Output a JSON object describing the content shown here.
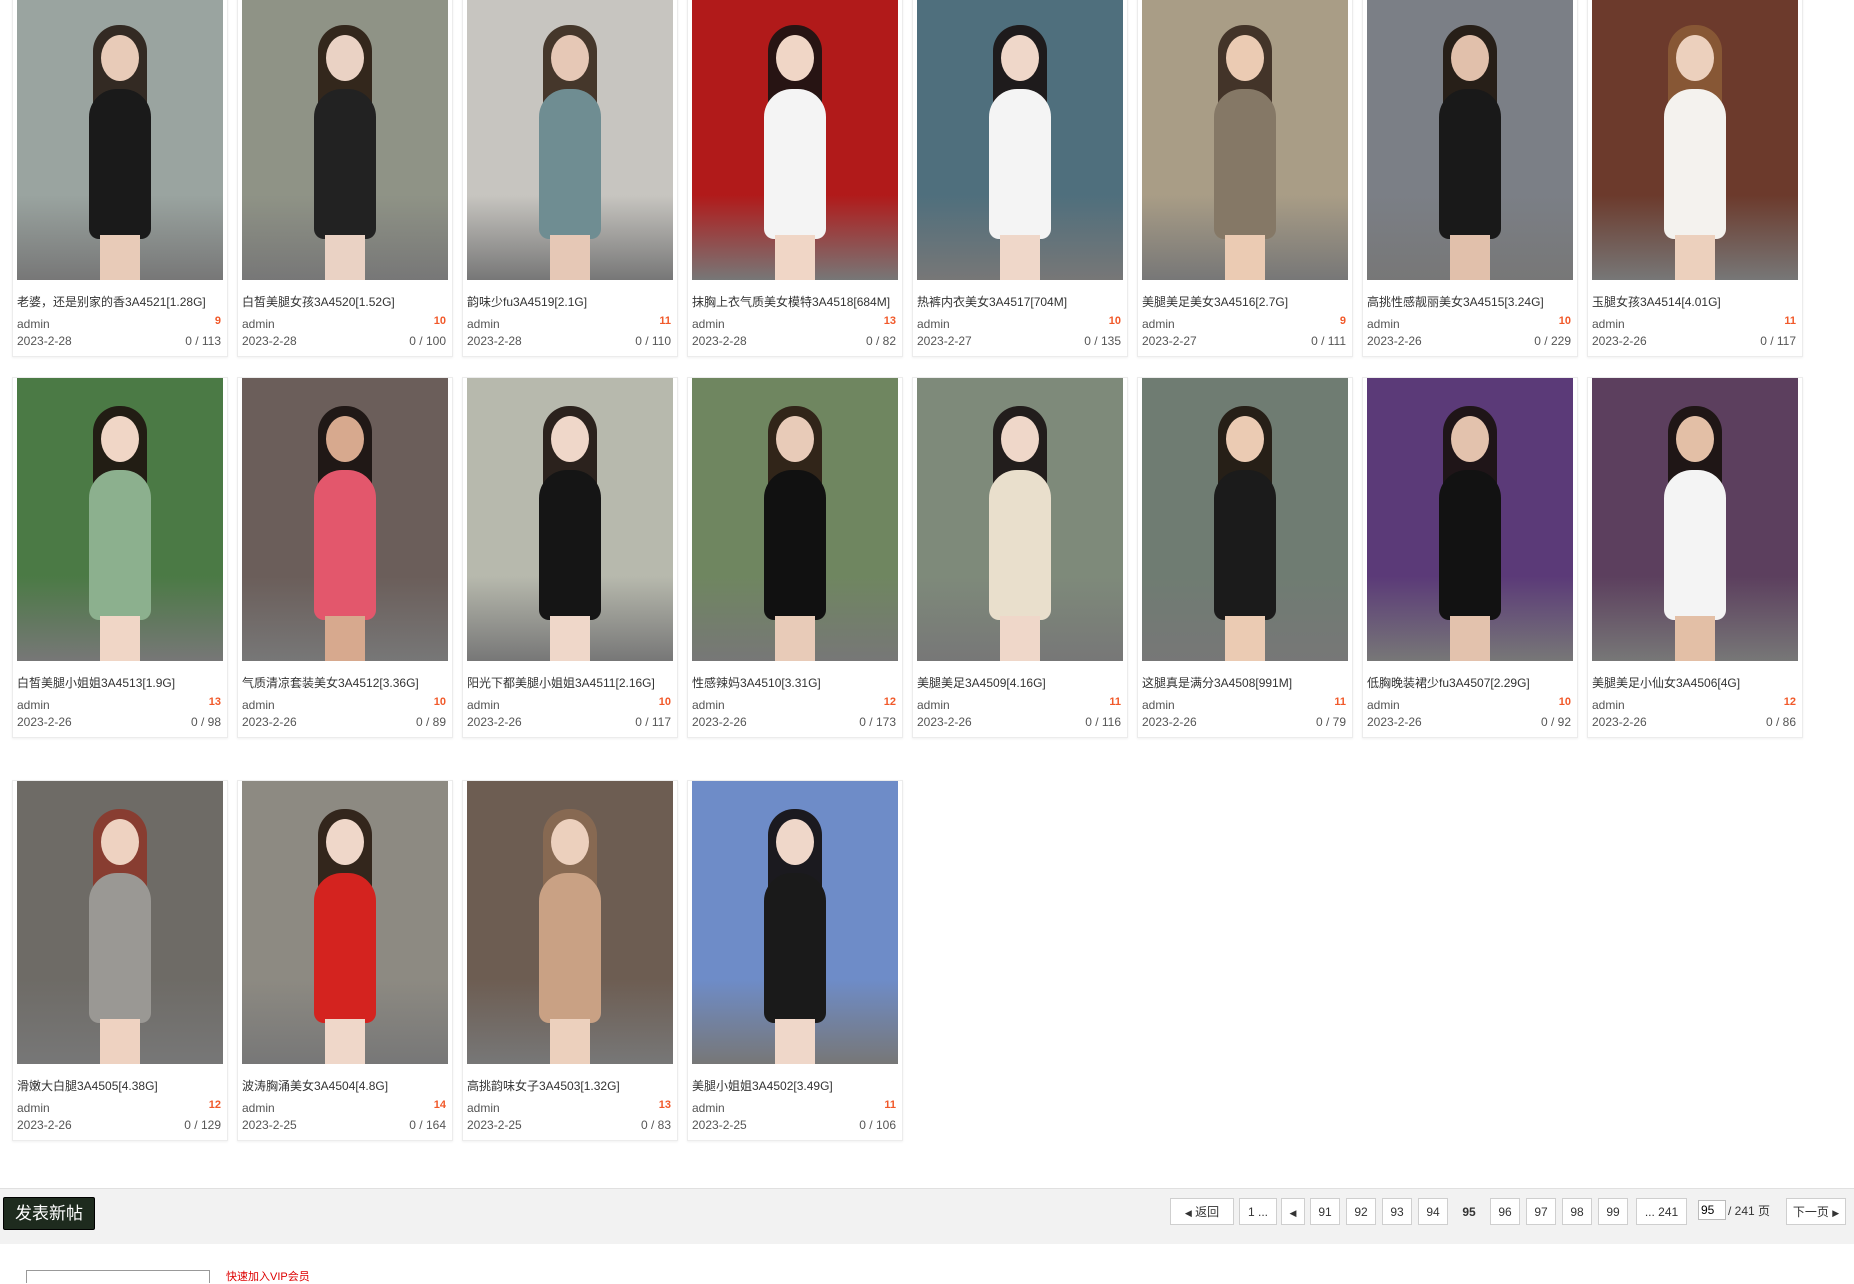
{
  "posts": [
    {
      "title": "老婆，还是别家的香3A4521[1.28G]",
      "author": "admin",
      "count": "9",
      "date": "2023-2-28",
      "views": "0 / 113",
      "palette": {
        "bg": "#9aa4a0",
        "body": "#1a1a1a",
        "hair": "#2a1f18",
        "skin": "#e8cbb8"
      }
    },
    {
      "title": "白皙美腿女孩3A4520[1.52G]",
      "author": "admin",
      "count": "10",
      "date": "2023-2-28",
      "views": "0 / 100",
      "palette": {
        "bg": "#8f9386",
        "body": "#222",
        "hair": "#2b1d14",
        "skin": "#ead2c4"
      }
    },
    {
      "title": "韵味少fu3A4519[2.1G]",
      "author": "admin",
      "count": "11",
      "date": "2023-2-28",
      "views": "0 / 110",
      "palette": {
        "bg": "#c7c5c0",
        "body": "#6f8d92",
        "hair": "#3a2a1e",
        "skin": "#e6c8b6"
      }
    },
    {
      "title": "抹胸上衣气质美女模特3A4518[684M]",
      "author": "admin",
      "count": "13",
      "date": "2023-2-28",
      "views": "0 / 82",
      "palette": {
        "bg": "#b11a1a",
        "body": "#f4f4f4",
        "hair": "#1b1412",
        "skin": "#f0d6c6"
      }
    },
    {
      "title": "热裤内衣美女3A4517[704M]",
      "author": "admin",
      "count": "10",
      "date": "2023-2-27",
      "views": "0 / 135",
      "palette": {
        "bg": "#4f6f7d",
        "body": "#f4f4f4",
        "hair": "#1a1414",
        "skin": "#efd7c9"
      }
    },
    {
      "title": "美腿美足美女3A4516[2.7G]",
      "author": "admin",
      "count": "9",
      "date": "2023-2-27",
      "views": "0 / 111",
      "palette": {
        "bg": "#a99d86",
        "body": "#857866",
        "hair": "#3b2b22",
        "skin": "#ebcbb3"
      }
    },
    {
      "title": "高挑性感靓丽美女3A4515[3.24G]",
      "author": "admin",
      "count": "10",
      "date": "2023-2-26",
      "views": "0 / 229",
      "palette": {
        "bg": "#7b7f86",
        "body": "#191919",
        "hair": "#20170f",
        "skin": "#e1c0ab"
      }
    },
    {
      "title": "玉腿女孩3A4514[4.01G]",
      "author": "admin",
      "count": "11",
      "date": "2023-2-26",
      "views": "0 / 117",
      "palette": {
        "bg": "#6c3a2c",
        "body": "#f4f2ee",
        "hair": "#8a5a36",
        "skin": "#ecd0bd"
      }
    },
    {
      "title": "白皙美腿小姐姐3A4513[1.9G]",
      "author": "admin",
      "count": "13",
      "date": "2023-2-26",
      "views": "0 / 98",
      "palette": {
        "bg": "#4b7a45",
        "body": "#8cb08e",
        "hair": "#1e1510",
        "skin": "#f0d6c6"
      }
    },
    {
      "title": "气质清凉套装美女3A4512[3.36G]",
      "author": "admin",
      "count": "10",
      "date": "2023-2-26",
      "views": "0 / 89",
      "palette": {
        "bg": "#6b5e5a",
        "body": "#e3576c",
        "hair": "#1a1210",
        "skin": "#d7a98e"
      }
    },
    {
      "title": "阳光下都美腿小姐姐3A4511[2.16G]",
      "author": "admin",
      "count": "10",
      "date": "2023-2-26",
      "views": "0 / 117",
      "palette": {
        "bg": "#b7b9ad",
        "body": "#151515",
        "hair": "#1e1510",
        "skin": "#efd7c9"
      }
    },
    {
      "title": "性感辣妈3A4510[3.31G]",
      "author": "admin",
      "count": "12",
      "date": "2023-2-26",
      "views": "0 / 173",
      "palette": {
        "bg": "#6f8660",
        "body": "#111",
        "hair": "#2b1d14",
        "skin": "#e8cbb8"
      }
    },
    {
      "title": "美腿美足3A4509[4.16G]",
      "author": "admin",
      "count": "11",
      "date": "2023-2-26",
      "views": "0 / 116",
      "palette": {
        "bg": "#7e8a7a",
        "body": "#e9dfcc",
        "hair": "#1a1414",
        "skin": "#efd7c9"
      }
    },
    {
      "title": "这腿真是满分3A4508[991M]",
      "author": "admin",
      "count": "11",
      "date": "2023-2-26",
      "views": "0 / 79",
      "palette": {
        "bg": "#6f7c72",
        "body": "#1b1b1b",
        "hair": "#20170f",
        "skin": "#ebcbb3"
      }
    },
    {
      "title": "低胸晚装裙少fu3A4507[2.29G]",
      "author": "admin",
      "count": "10",
      "date": "2023-2-26",
      "views": "0 / 92",
      "palette": {
        "bg": "#5b3a78",
        "body": "#121212",
        "hair": "#1a1210",
        "skin": "#e3c2ad"
      }
    },
    {
      "title": "美腿美足小仙女3A4506[4G]",
      "author": "admin",
      "count": "12",
      "date": "2023-2-26",
      "views": "0 / 86",
      "palette": {
        "bg": "#5c3f5e",
        "body": "#f4f4f4",
        "hair": "#1a1210",
        "skin": "#e3bfa6"
      }
    },
    {
      "title": "滑嫩大白腿3A4505[4.38G]",
      "author": "admin",
      "count": "12",
      "date": "2023-2-26",
      "views": "0 / 129",
      "palette": {
        "bg": "#6e6b66",
        "body": "#9a9894",
        "hair": "#8a3a2c",
        "skin": "#eed2c1"
      }
    },
    {
      "title": "波涛胸涌美女3A4504[4.8G]",
      "author": "admin",
      "count": "14",
      "date": "2023-2-25",
      "views": "0 / 164",
      "palette": {
        "bg": "#8d8a82",
        "body": "#d4231f",
        "hair": "#2b1d14",
        "skin": "#efd7c9"
      }
    },
    {
      "title": "高挑韵味女子3A4503[1.32G]",
      "author": "admin",
      "count": "13",
      "date": "2023-2-25",
      "views": "0 / 83",
      "palette": {
        "bg": "#6d5d52",
        "body": "#c9a184",
        "hair": "#8a6a52",
        "skin": "#ecd0bd"
      }
    },
    {
      "title": "美腿小姐姐3A4502[3.49G]",
      "author": "admin",
      "count": "11",
      "date": "2023-2-25",
      "views": "0 / 106",
      "palette": {
        "bg": "#6e8cc8",
        "body": "#1a1a1a",
        "hair": "#141010",
        "skin": "#efd7c9"
      }
    }
  ],
  "toolbar": {
    "new_post_label": "发表新帖"
  },
  "pagination": {
    "back_label": "返回",
    "first_label": "1 ...",
    "prev_icon": "chevron-left-icon",
    "pages": [
      "91",
      "92",
      "93",
      "94",
      "95",
      "96",
      "97",
      "98",
      "99"
    ],
    "current": "95",
    "last_label": "... 241",
    "input_value": "95",
    "total_label": "/ 241 页",
    "next_label": "下一页"
  },
  "footer": {
    "red_link": "快速加入VIP会员"
  }
}
